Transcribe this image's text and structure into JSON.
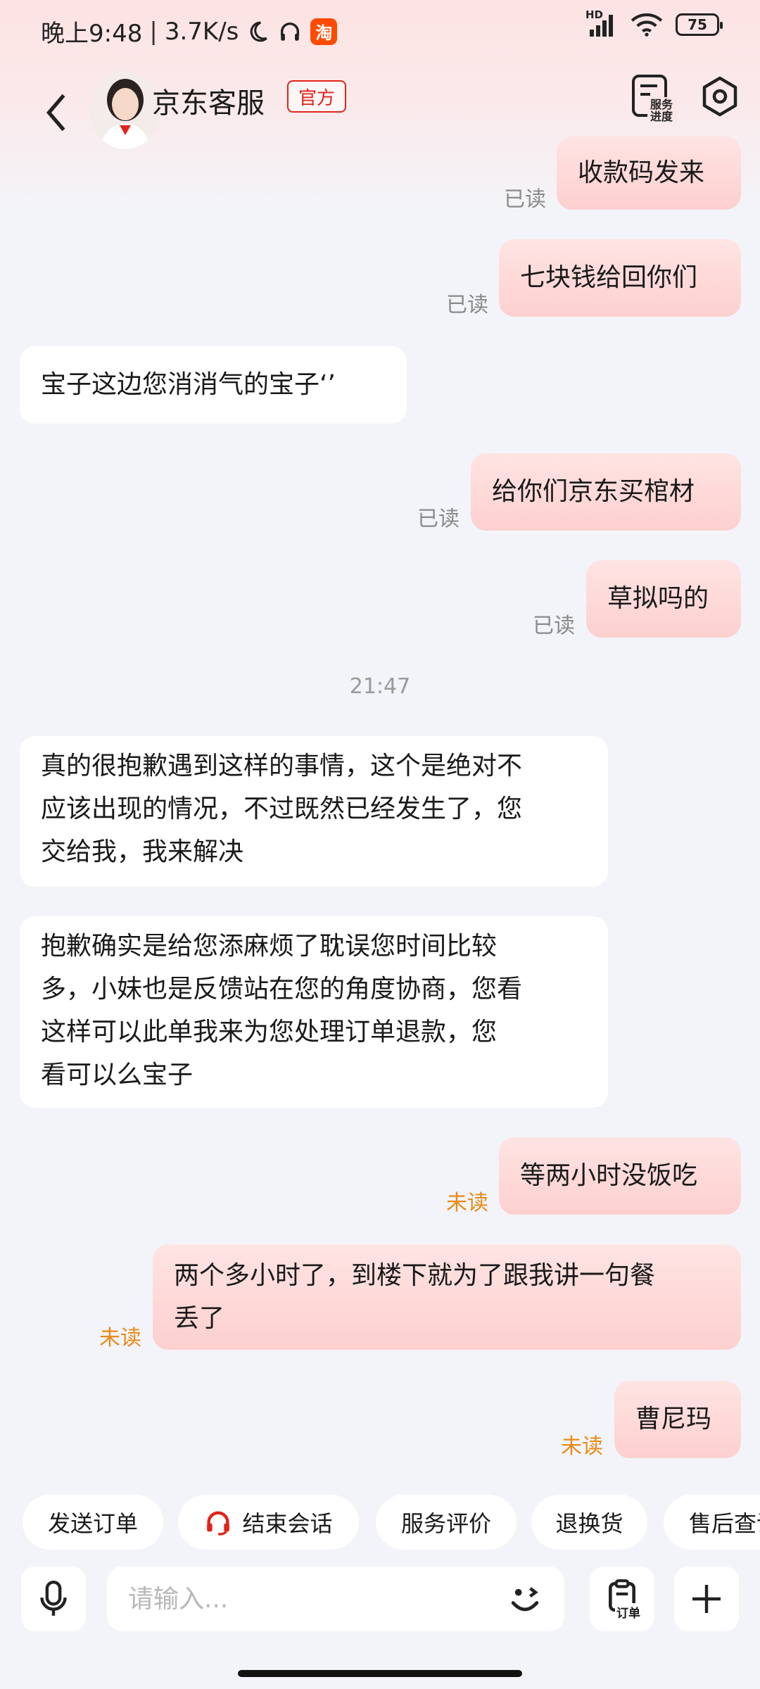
{
  "status_bar": {
    "time": "晚上9:48",
    "net_speed": "3.7K/s",
    "network": "HD",
    "battery": "75",
    "taobao_label": "淘"
  },
  "header": {
    "title": "京东客服",
    "badge": "官方",
    "service_progress": "服务进度"
  },
  "messages": [
    {
      "side": "out",
      "text": "收款码发来",
      "status": "已读"
    },
    {
      "side": "out",
      "text": "七块钱给回你们",
      "status": "已读"
    },
    {
      "side": "in",
      "text": "宝子这边您消消气的宝子‘’"
    },
    {
      "side": "out",
      "text": "给你们京东买棺材",
      "status": "已读"
    },
    {
      "side": "out",
      "text": "草拟吗的",
      "status": "已读"
    },
    {
      "side": "in",
      "lines": [
        "真的很抱歉遇到这样的事情，这个是绝对不",
        "应该出现的情况，不过既然已经发生了，您",
        "交给我，我来解决"
      ]
    },
    {
      "side": "in",
      "lines": [
        "抱歉确实是给您添麻烦了耽误您时间比较",
        "多，小妹也是反馈站在您的角度协商，您看",
        "这样可以此单我来为您处理订单退款，您",
        "看可以么宝子"
      ]
    },
    {
      "side": "out",
      "text": "等两小时没饭吃",
      "status": "未读"
    },
    {
      "side": "out",
      "lines": [
        "两个多小时了，到楼下就为了跟我讲一句餐",
        "丢了"
      ],
      "status": "未读"
    },
    {
      "side": "out",
      "text": "曹尼玛",
      "status": "未读"
    }
  ],
  "time_separator": "21:47",
  "quick_actions": [
    "发送订单",
    "结束会话",
    "服务评价",
    "退换货",
    "售后查询"
  ],
  "input": {
    "placeholder": "请输入...",
    "order_label": "订单"
  },
  "colors": {
    "accent": "#e2231a",
    "outgoing_bubble": "#fdd5d4",
    "unread": "#e88a17",
    "background": "#f3f4f9"
  }
}
